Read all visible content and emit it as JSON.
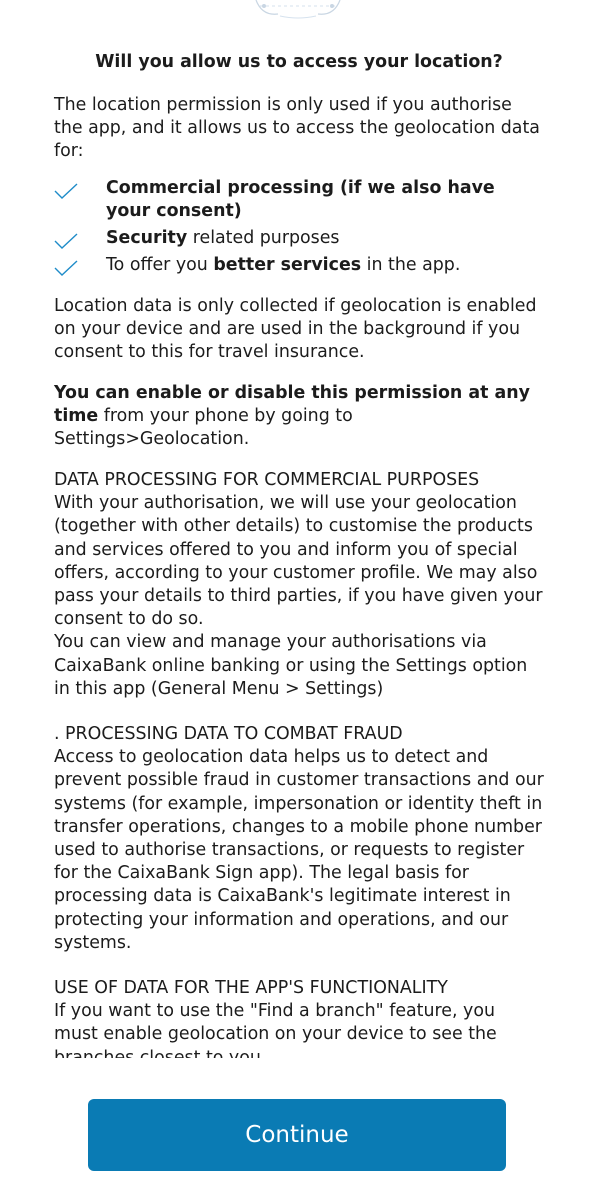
{
  "title": "Will you allow us to access your location?",
  "intro": "The location permission is only used if you authorise the app, and it allows us to access the geolocation data for:",
  "checklist": [
    {
      "bold": "Commercial processing (if we also have your consent)",
      "text": "",
      "bold_after": ""
    },
    {
      "bold": "Security",
      "text": " related purposes",
      "bold_after": ""
    },
    {
      "prefix": "To offer you ",
      "bold": "better services",
      "text": " in the app."
    }
  ],
  "location_note": "Location data is only collected if geolocation is enabled on your device and are used in the background if you consent to this for travel insurance.",
  "permission": {
    "bold": "You can enable or disable this permission at any time",
    "text": " from your phone by going to Settings>Geolocation."
  },
  "sections": {
    "commercial": {
      "heading": "DATA PROCESSING FOR COMMERCIAL PURPOSES",
      "body": "With your authorisation, we will use your geolocation (together with other details) to customise the products and services offered to you and inform you of special offers, according to your customer profile. We may also pass your details to third parties, if you have given your consent to do so.",
      "body2": "You can view and manage your authorisations via CaixaBank online banking or using the Settings option in this app (General Menu > Settings)"
    },
    "fraud": {
      "heading": ". PROCESSING DATA TO COMBAT FRAUD",
      "body": "Access to geolocation data helps us to detect and prevent possible fraud in customer transactions and our systems (for example, impersonation or identity theft in transfer operations, changes to a mobile phone number used to authorise transactions, or requests to register for the CaixaBank Sign app). The legal basis for processing data is CaixaBank's legitimate interest in protecting your information and operations, and our systems."
    },
    "functionality": {
      "heading": "USE OF DATA FOR THE APP'S FUNCTIONALITY",
      "body": "If you want to use the \"Find a branch\" feature, you must enable geolocation on your device to see the branches closest to you."
    }
  },
  "continue_label": "Continue",
  "colors": {
    "accent": "#0a7bb4",
    "check": "#1f8cc9",
    "text": "#1c1c1c"
  },
  "icons": {
    "check": "check-icon",
    "illustration": "map-pin-illustration"
  }
}
